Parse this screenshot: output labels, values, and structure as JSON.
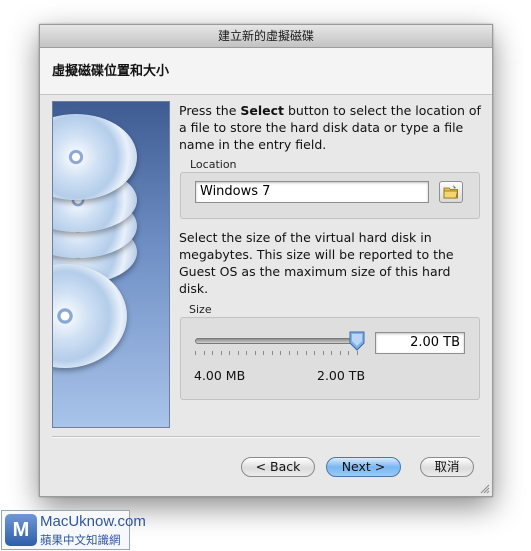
{
  "window": {
    "title": "建立新的虛擬磁碟"
  },
  "header": {
    "title": "虛擬磁碟位置和大小"
  },
  "description": {
    "before_bold": "Press the ",
    "bold": "Select",
    "after_bold": " button to select the location of a file to store the hard disk data or type a file name in the entry field."
  },
  "location": {
    "label": "Location",
    "value": "Windows 7",
    "browse_icon": "folder-icon"
  },
  "size_description": "Select the size of the virtual hard disk in megabytes. This size will be reported to the Guest OS as the maximum size of this hard disk.",
  "size": {
    "label": "Size",
    "value": "2.00 TB",
    "slider_min_label": "4.00 MB",
    "slider_max_label": "2.00 TB",
    "slider_fraction": 1.0
  },
  "buttons": {
    "back": "< Back",
    "next": "Next >",
    "cancel": "取消"
  },
  "watermark": {
    "brand": "MacUknow.com",
    "subtitle": "蘋果中文知識網",
    "logo_letter": "M"
  },
  "colors": {
    "default_button": "#79b6f0",
    "sidebar_dark": "#3e5c92",
    "sidebar_light": "#a9c4ea"
  }
}
